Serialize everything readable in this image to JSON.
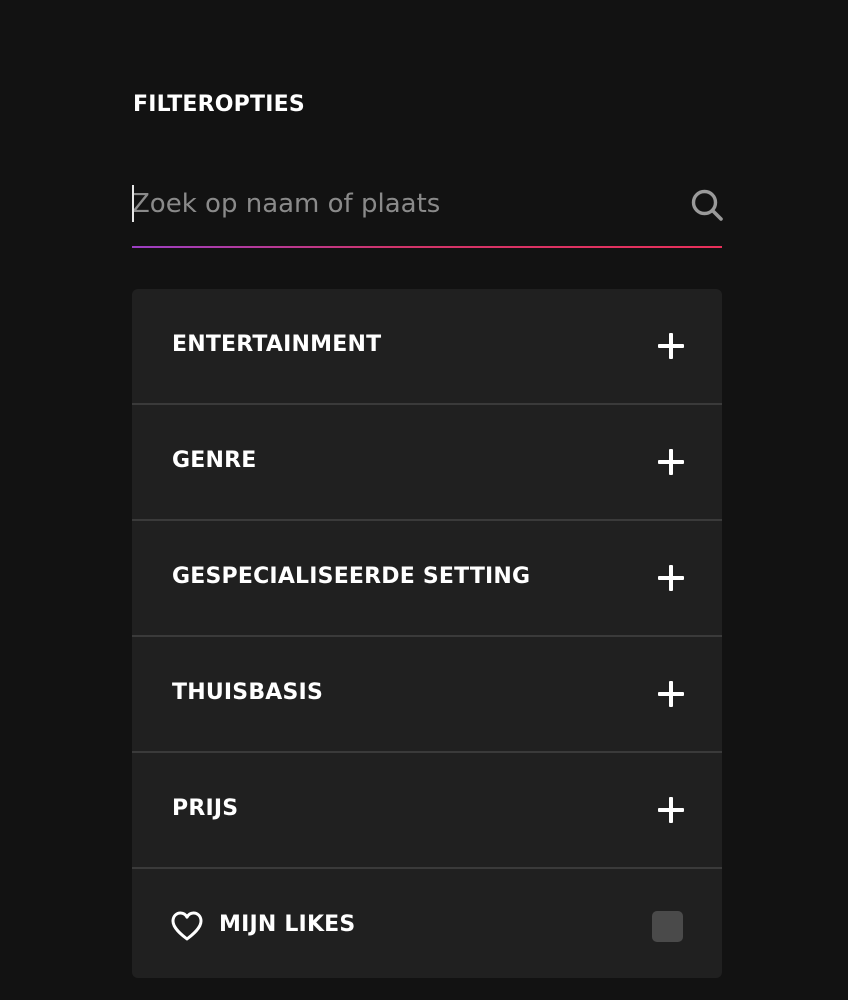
{
  "filter": {
    "heading": "FILTEROPTIES",
    "search": {
      "placeholder": "Zoek op naam of plaats",
      "value": "",
      "icon": "search-icon"
    },
    "accent_gradient": [
      "#9b3fc4",
      "#d0346a",
      "#e8305a"
    ],
    "categories": [
      {
        "label": "ENTERTAINMENT",
        "icon": "plus-icon"
      },
      {
        "label": "GENRE",
        "icon": "plus-icon"
      },
      {
        "label": "GESPECIALISEERDE SETTING",
        "icon": "plus-icon"
      },
      {
        "label": "THUISBASIS",
        "icon": "plus-icon"
      },
      {
        "label": "PRIJS",
        "icon": "plus-icon"
      }
    ],
    "likes": {
      "label": "MIJN LIKES",
      "icon": "heart-icon",
      "checked": false
    }
  }
}
